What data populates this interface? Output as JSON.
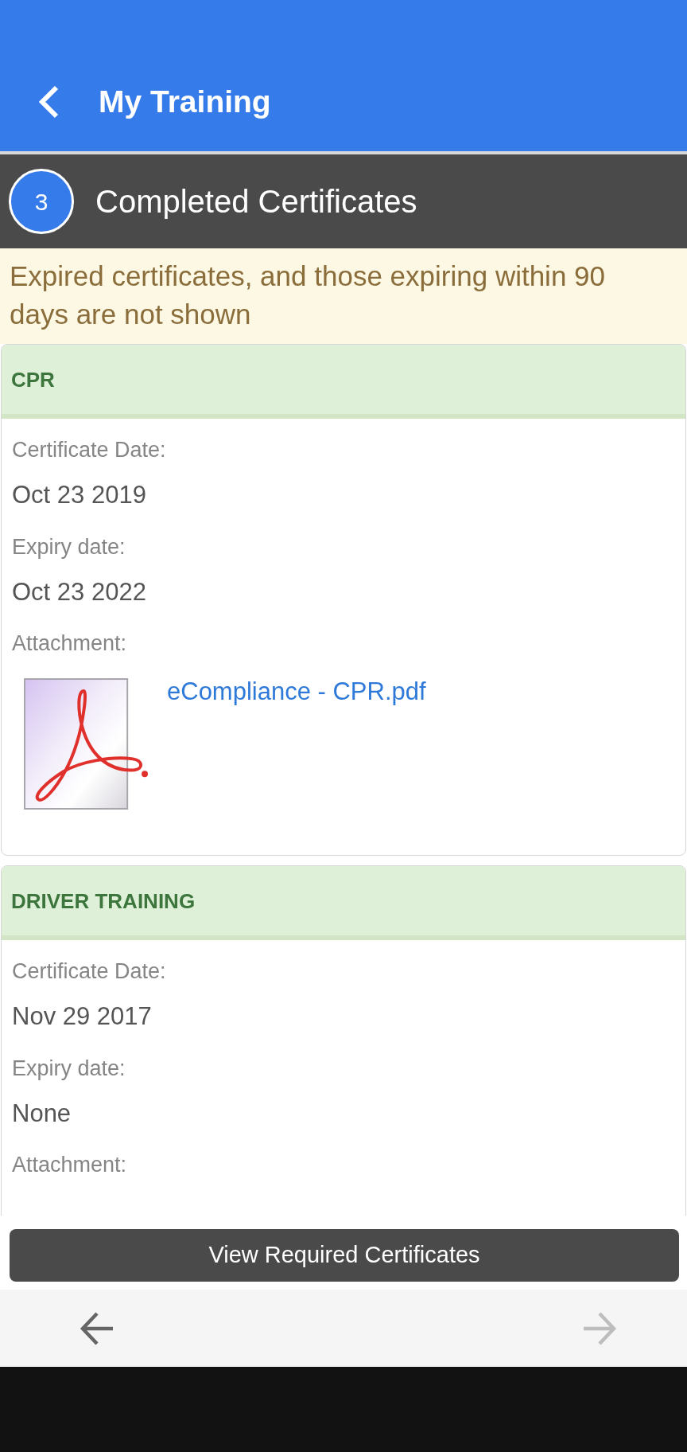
{
  "app_bar": {
    "title": "My Training"
  },
  "section": {
    "number": "3",
    "title": "Completed Certificates"
  },
  "notice": "Expired certificates, and those expiring within 90 days are not shown",
  "certificates": [
    {
      "name": "CPR",
      "fields": [
        {
          "label": "Certificate Date:",
          "value": "Oct 23 2019"
        },
        {
          "label": "Expiry date:",
          "value": "Oct 23 2022"
        }
      ],
      "attachment": {
        "label": "Attachment:",
        "file_name": "eCompliance - CPR.pdf"
      }
    },
    {
      "name": "DRIVER TRAINING",
      "fields": [
        {
          "label": "Certificate Date:",
          "value": "Nov 29 2017"
        },
        {
          "label": "Expiry date:",
          "value": "None"
        }
      ],
      "attachment": {
        "label": "Attachment:"
      }
    }
  ],
  "button": "View Required Certificates",
  "nav": [
    {
      "kind": "back",
      "disabled": false
    },
    {
      "kind": "forward",
      "disabled": true
    }
  ]
}
